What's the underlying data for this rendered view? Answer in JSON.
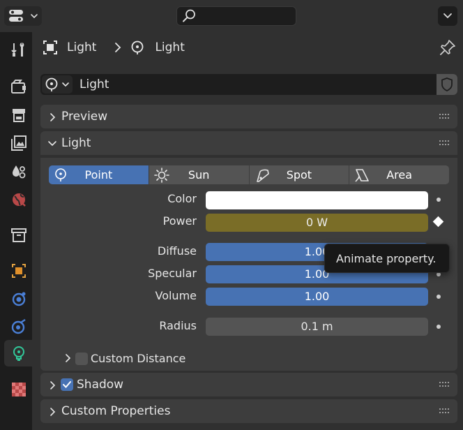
{
  "header": {
    "editor_type_icon": "properties-editor-icon",
    "search_icon": "search-icon",
    "menu_icon": "chevron-down-icon",
    "search": {
      "value": "",
      "placeholder": ""
    }
  },
  "breadcrumb": {
    "object": "Light",
    "data": "Light",
    "separator_icon": "chevron-right-icon",
    "pin_icon": "pin-icon"
  },
  "datablock": {
    "name": "Light",
    "type_icon": "light-icon",
    "fake_user_icon": "shield-icon"
  },
  "tabs": [
    {
      "name": "tool",
      "icon": "tool-icon",
      "active": false
    },
    {
      "name": "render",
      "icon": "render-icon",
      "active": false
    },
    {
      "name": "output",
      "icon": "output-icon",
      "active": false
    },
    {
      "name": "view-layer",
      "icon": "view-layer-icon",
      "active": false
    },
    {
      "name": "scene",
      "icon": "scene-icon",
      "active": false
    },
    {
      "name": "world",
      "icon": "world-icon",
      "active": false
    },
    {
      "name": "collection",
      "icon": "collection-icon",
      "active": false
    },
    {
      "name": "object",
      "icon": "object-icon",
      "active": false
    },
    {
      "name": "physics",
      "icon": "physics-icon",
      "active": false
    },
    {
      "name": "constraints",
      "icon": "constraints-icon",
      "active": false
    },
    {
      "name": "light-data",
      "icon": "light-bulb-icon",
      "active": true
    },
    {
      "name": "texture",
      "icon": "texture-icon",
      "active": false
    }
  ],
  "panels": {
    "preview": {
      "label": "Preview",
      "expanded": false
    },
    "light": {
      "label": "Light",
      "expanded": true,
      "types": [
        {
          "label": "Point",
          "icon": "point-light-icon",
          "selected": true
        },
        {
          "label": "Sun",
          "icon": "sun-icon",
          "selected": false
        },
        {
          "label": "Spot",
          "icon": "spot-light-icon",
          "selected": false
        },
        {
          "label": "Area",
          "icon": "area-light-icon",
          "selected": false
        }
      ],
      "color": {
        "label": "Color",
        "value": "#ffffff"
      },
      "power": {
        "label": "Power",
        "value": "0 W"
      },
      "diffuse": {
        "label": "Diffuse",
        "value": "1.00"
      },
      "specular": {
        "label": "Specular",
        "value": "1.00"
      },
      "volume": {
        "label": "Volume",
        "value": "1.00"
      },
      "radius": {
        "label": "Radius",
        "value": "0.1 m"
      },
      "custom_distance": {
        "label": "Custom Distance",
        "checked": false
      }
    },
    "shadow": {
      "label": "Shadow",
      "checked": true,
      "expanded": false
    },
    "custom_properties": {
      "label": "Custom Properties",
      "expanded": false
    }
  },
  "tooltip": {
    "text": "Animate property."
  },
  "colors": {
    "accent": "#4772b3",
    "animated": "#7a6d27",
    "panel": "#3d3d3d",
    "background": "#303030",
    "tab_bar": "#1d1d1d"
  }
}
